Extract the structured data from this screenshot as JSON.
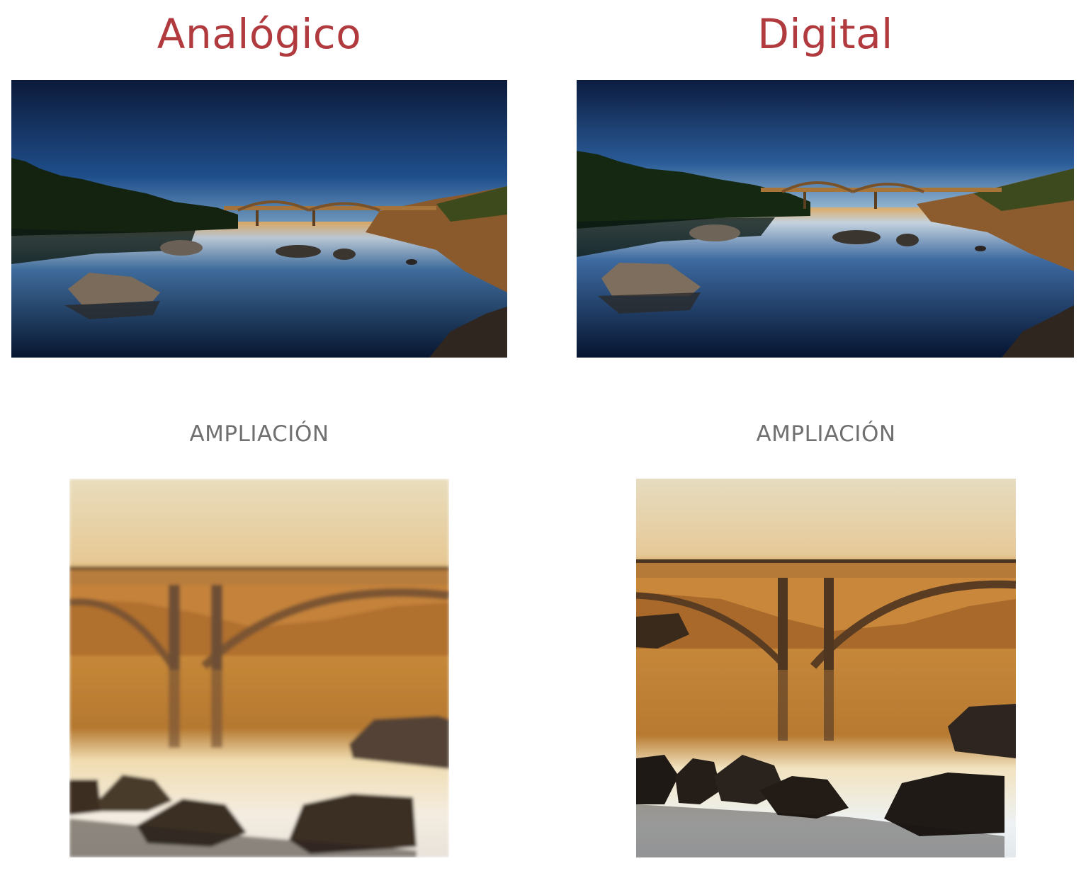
{
  "accent_color": "#b03a3e",
  "columns": [
    {
      "title": "Analógico",
      "zoom_label": "AMPLIACIÓN"
    },
    {
      "title": "Digital",
      "zoom_label": "AMPLIACIÓN"
    }
  ]
}
